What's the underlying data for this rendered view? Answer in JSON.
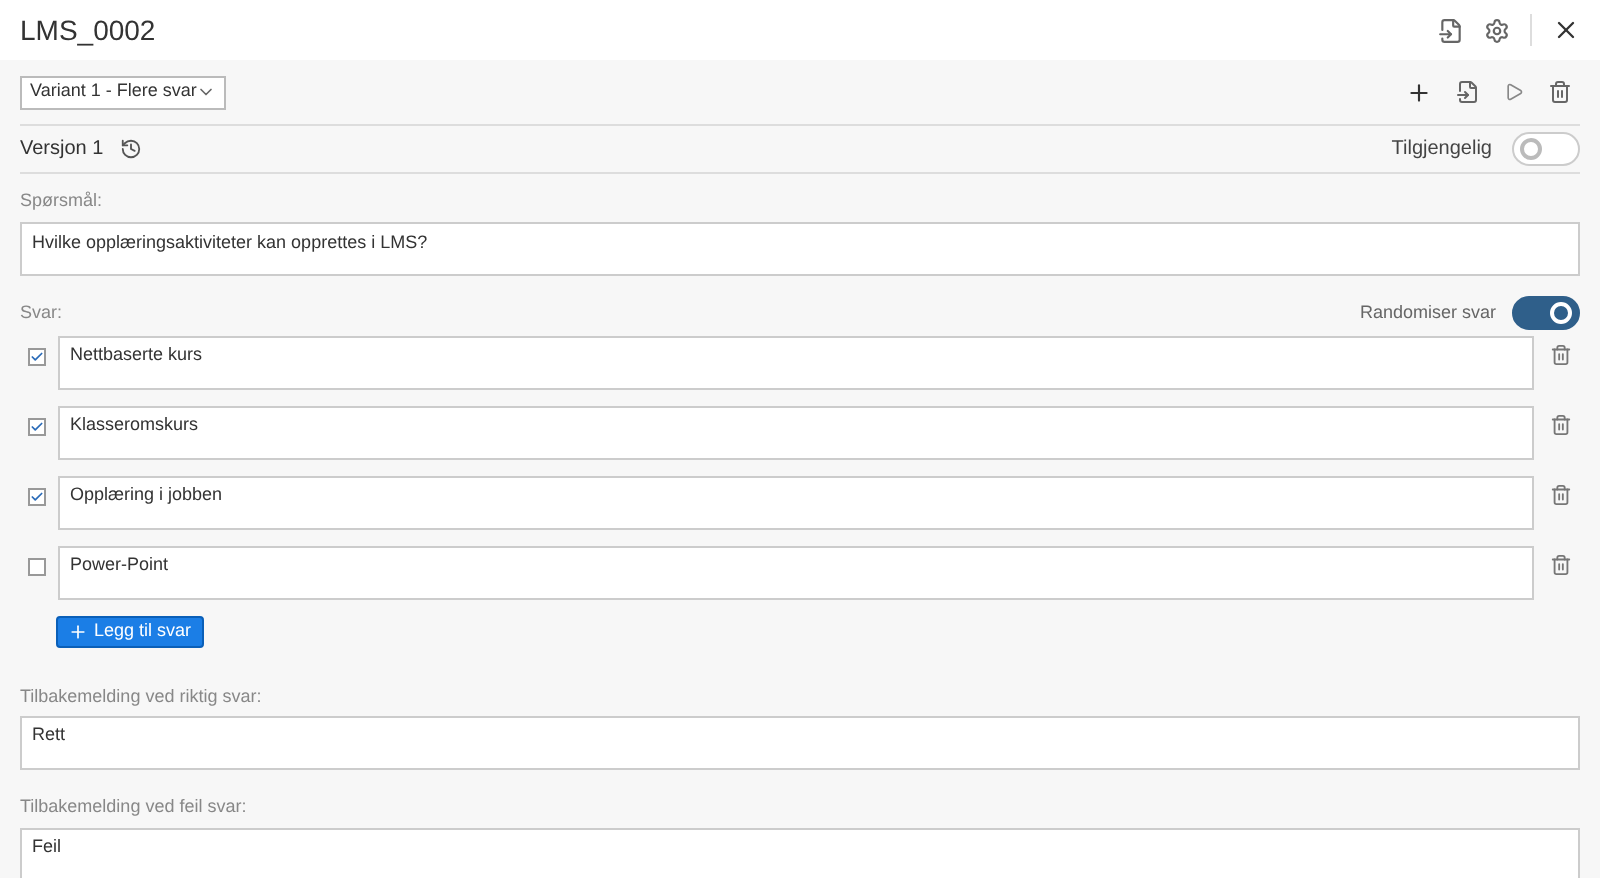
{
  "window": {
    "title": "LMS_0002"
  },
  "variant_select": {
    "value": "Variant 1 - Flere svar"
  },
  "version": {
    "label": "Versjon 1"
  },
  "available": {
    "label": "Tilgjengelig",
    "on": false
  },
  "question": {
    "label": "Spørsmål:",
    "value": "Hvilke opplæringsaktiviteter kan opprettes i LMS?"
  },
  "answers_label": "Svar:",
  "randomize": {
    "label": "Randomiser svar",
    "on": true
  },
  "answers": [
    {
      "text": "Nettbaserte kurs",
      "checked": true
    },
    {
      "text": "Klasseromskurs",
      "checked": true
    },
    {
      "text": "Opplæring i jobben",
      "checked": true
    },
    {
      "text": "Power-Point",
      "checked": false
    }
  ],
  "add_button": "Legg til svar",
  "feedback_correct": {
    "label": "Tilbakemelding ved riktig svar:",
    "value": "Rett"
  },
  "feedback_wrong": {
    "label": "Tilbakemelding ved feil svar:",
    "value": "Feil"
  }
}
